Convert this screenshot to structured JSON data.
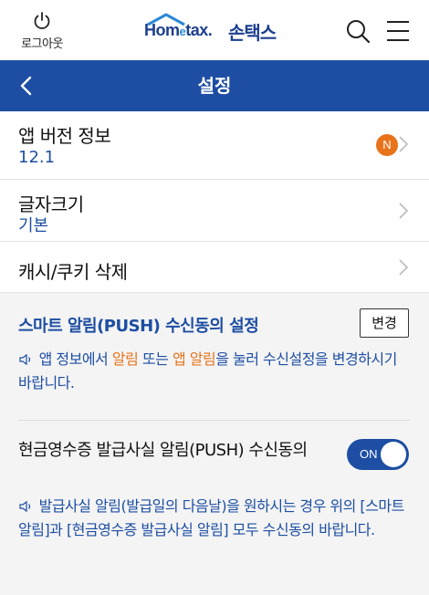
{
  "topbar": {
    "logout_label": "로그아웃",
    "logo_en": "Hom",
    "logo_en_e": "e",
    "logo_en_tail": "tax.",
    "logo_ko": "손택스"
  },
  "header": {
    "title": "설정"
  },
  "rows": [
    {
      "title": "앱 버전 정보",
      "value": "12.1",
      "badge": "N"
    },
    {
      "title": "글자크기",
      "value": "기본"
    },
    {
      "title": "캐시/쿠키 삭제"
    }
  ],
  "push_section": {
    "title": "스마트 알림(PUSH) 수신동의 설정",
    "change_label": "변경",
    "note_parts": [
      "앱 정보에서 ",
      "알림",
      " 또는 ",
      "앱 알림",
      "을 눌러 수신설정을 변경하시기 바랍니다."
    ],
    "cash_receipt_title": "현금영수증 발급사실 알림(PUSH) 수신동의",
    "toggle_label": "ON",
    "toggle_on": true,
    "note2": "발급사실 알림(발급일의 다음날)을 원하시는 경우 위의 [스마트 알림]과 [현금영수증 발급사실 알림] 모두 수신동의 바랍니다."
  },
  "colors": {
    "brand_blue": "#1d4ea3",
    "accent_orange": "#e8731a"
  },
  "icons": [
    "power-icon",
    "search-icon",
    "menu-icon",
    "back-icon",
    "chevron-right-icon",
    "speaker-icon"
  ]
}
